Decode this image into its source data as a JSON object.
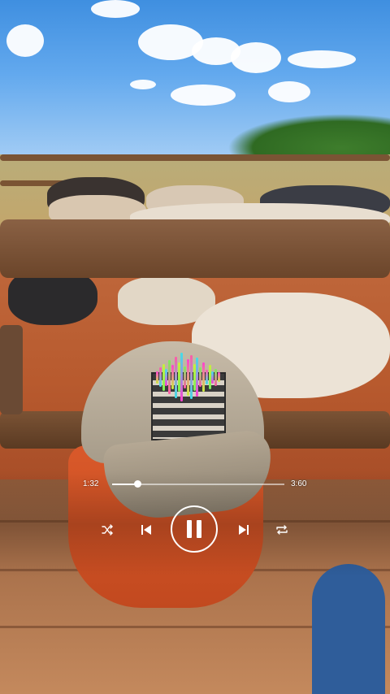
{
  "player": {
    "time_elapsed": "1:32",
    "time_total": "3:60",
    "progress": 0.15
  },
  "controls": {
    "shuffle": "shuffle-icon",
    "previous": "previous-icon",
    "pause": "pause-icon",
    "next": "next-icon",
    "repeat": "repeat-icon"
  },
  "visualizer": {
    "colors": [
      "#ff3fd0",
      "#ff5aa8",
      "#c9f03c",
      "#3fe0e8",
      "#7cf05a"
    ],
    "levels": [
      0.25,
      0.4,
      0.55,
      0.35,
      0.7,
      0.5,
      0.85,
      0.6,
      1.0,
      0.45,
      0.75,
      0.9,
      0.55,
      0.8,
      0.4,
      0.6,
      0.3,
      0.5,
      0.25,
      0.35,
      0.2
    ]
  },
  "colors": {
    "accent": "#ffffff",
    "track": "#ffffff"
  }
}
